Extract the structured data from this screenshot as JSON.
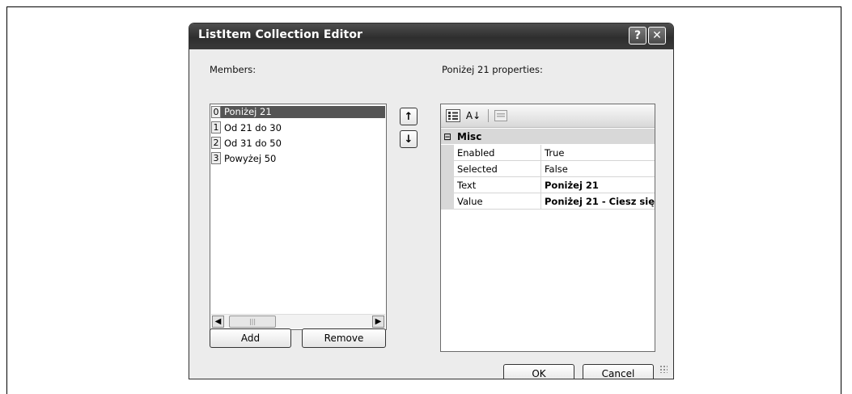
{
  "dialog": {
    "title": "ListItem Collection Editor",
    "help_label": "?",
    "close_label": "✕"
  },
  "members": {
    "label": "Members:",
    "items": [
      {
        "index": "0",
        "text": "Poniżej 21",
        "selected": true
      },
      {
        "index": "1",
        "text": "Od 21 do 30",
        "selected": false
      },
      {
        "index": "2",
        "text": "Od 31 do 50",
        "selected": false
      },
      {
        "index": "3",
        "text": "Powyżej 50",
        "selected": false
      }
    ],
    "scroll_left": "◀",
    "scroll_right": "▶",
    "thumb_grip": "|||"
  },
  "move": {
    "up_label": "↑",
    "down_label": "↓"
  },
  "buttons": {
    "add": "Add",
    "remove": "Remove",
    "ok": "OK",
    "cancel": "Cancel"
  },
  "properties": {
    "label": "Poniżej 21 properties:",
    "toolbar": {
      "categorized_icon": "categorized-icon",
      "alphabetical_icon": "alphabetical-icon",
      "alphabetical_glyph": "A↓",
      "property_pages_icon": "property-pages-icon"
    },
    "category": {
      "expander": "⊟",
      "name": "Misc"
    },
    "rows": [
      {
        "name": "Enabled",
        "value": "True",
        "bold": false
      },
      {
        "name": "Selected",
        "value": "False",
        "bold": false
      },
      {
        "name": "Text",
        "value": "Poniżej 21",
        "bold": true
      },
      {
        "name": "Value",
        "value": "Poniżej 21 - Ciesz się",
        "bold": true
      }
    ]
  },
  "colors": {
    "titlebar": "#3a3a3a",
    "selection": "#555555",
    "dialog_bg": "#ececec"
  }
}
